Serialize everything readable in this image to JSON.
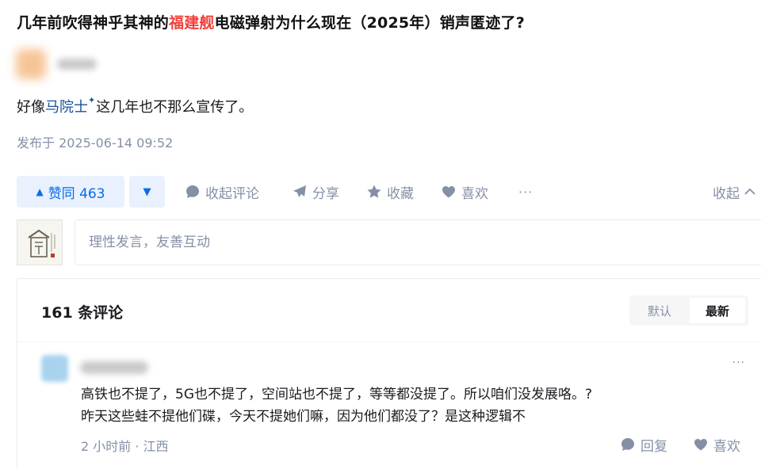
{
  "question": {
    "title_before": "几年前吹得神乎其神的",
    "title_highlight": "福建舰",
    "title_after": "电磁弹射为什么现在（2025年）销声匿迹了?"
  },
  "answer": {
    "text_before": "好像",
    "link_text": "马院士",
    "text_after": "这几年也不那么宣传了。",
    "published": "发布于 2025-06-14 09:52"
  },
  "actions": {
    "upvote_label": "赞同 463",
    "comment_label": "收起评论",
    "share_label": "分享",
    "favorite_label": "收藏",
    "like_label": "喜欢",
    "more_label": "···",
    "collapse_label": "收起"
  },
  "comment_box": {
    "placeholder": "理性发言，友善互动"
  },
  "comments": {
    "count_label": "161 条评论",
    "sort_default": "默认",
    "sort_newest": "最新",
    "items": [
      {
        "line1": "高铁也不提了，5G也不提了，空间站也不提了，等等都没提了。所以咱们没发展咯。?",
        "line2": "昨天这些蛙不提他们碟，今天不提她们嘛，因为他们都没了？是这种逻辑不",
        "meta": "2 小时前 · 江西",
        "reply_label": "回复",
        "like_label": "喜欢",
        "more_label": "···"
      }
    ]
  },
  "colors": {
    "brand_blue": "#056de8",
    "highlight_red": "#f1403c",
    "muted_gray": "#8590a6",
    "link_blue": "#175199"
  },
  "icons": [
    "triangle-up-icon",
    "triangle-down-icon",
    "comment-bubble-icon",
    "paper-plane-icon",
    "star-icon",
    "heart-icon",
    "more-dots-icon",
    "chevron-up-icon"
  ]
}
